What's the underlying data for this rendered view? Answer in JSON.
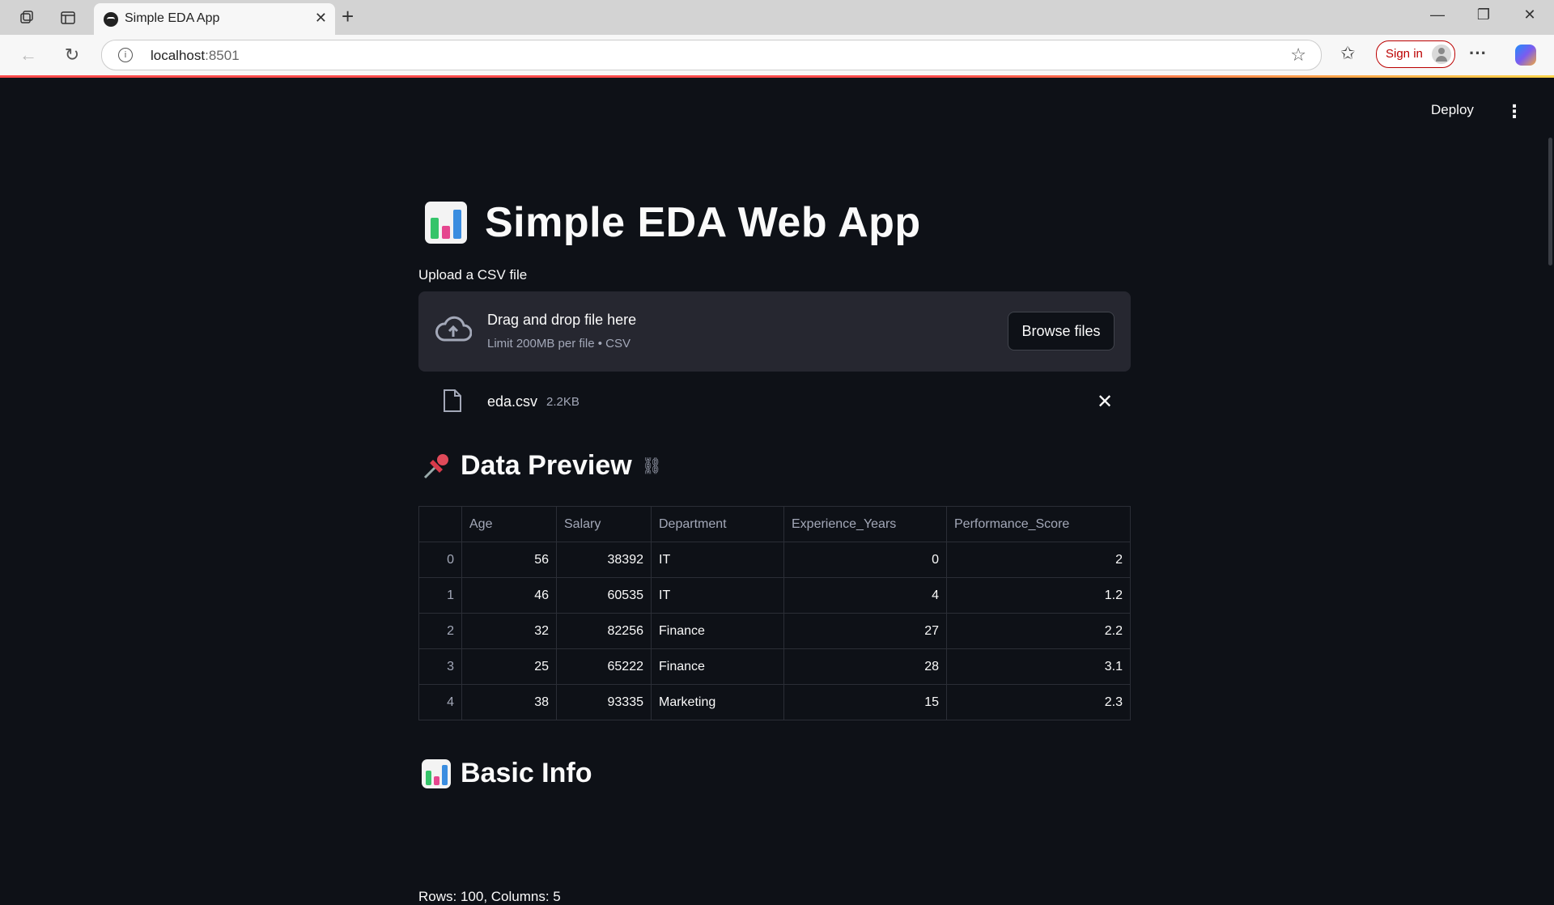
{
  "browser": {
    "tab_title": "Simple EDA App",
    "url_host": "localhost",
    "url_port": ":8501",
    "signin_label": "Sign in"
  },
  "app": {
    "deploy_label": "Deploy",
    "title": "Simple EDA Web App",
    "upload_label": "Upload a CSV file",
    "dropzone_title": "Drag and drop file here",
    "dropzone_sub": "Limit 200MB per file • CSV",
    "browse_label": "Browse files",
    "file_name": "eda.csv",
    "file_size": "2.2KB",
    "preview_heading": "Data Preview",
    "basic_info_heading": "Basic Info",
    "basic_info_text": "Rows: 100, Columns: 5"
  },
  "table": {
    "columns": [
      "",
      "Age",
      "Salary",
      "Department",
      "Experience_Years",
      "Performance_Score"
    ],
    "rows": [
      [
        "0",
        "56",
        "38392",
        "IT",
        "0",
        "2"
      ],
      [
        "1",
        "46",
        "60535",
        "IT",
        "4",
        "1.2"
      ],
      [
        "2",
        "32",
        "82256",
        "Finance",
        "27",
        "2.2"
      ],
      [
        "3",
        "25",
        "65222",
        "Finance",
        "28",
        "3.1"
      ],
      [
        "4",
        "38",
        "93335",
        "Marketing",
        "15",
        "2.3"
      ]
    ]
  },
  "colors": {
    "background": "#0e1117",
    "accent": "#ff4b4b",
    "dropzone": "#262730"
  }
}
